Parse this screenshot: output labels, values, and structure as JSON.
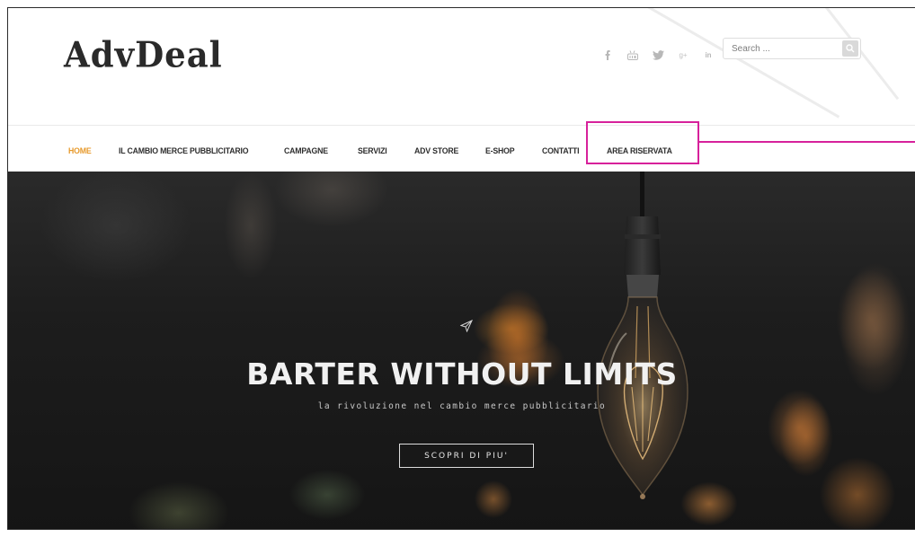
{
  "header": {
    "logo_text": "AdvDeal",
    "social_icons": [
      "facebook-icon",
      "youtube-icon",
      "twitter-icon",
      "google-plus-icon",
      "linkedin-icon"
    ],
    "search": {
      "placeholder": "Search ..."
    }
  },
  "nav": {
    "items": [
      {
        "label": "HOME",
        "active": true
      },
      {
        "label": "IL CAMBIO MERCE PUBBLICITARIO",
        "active": false
      },
      {
        "label": "CAMPAGNE",
        "active": false
      },
      {
        "label": "SERVIZI",
        "active": false
      },
      {
        "label": "ADV STORE",
        "active": false
      },
      {
        "label": "E-SHOP",
        "active": false
      },
      {
        "label": "CONTATTI",
        "active": false
      },
      {
        "label": "AREA RISERVATA",
        "active": false
      }
    ],
    "highlighted_item": "AREA RISERVATA"
  },
  "hero": {
    "title": "BARTER WITHOUT LIMITS",
    "subtitle": "la rivoluzione nel cambio merce pubblicitario",
    "button_label": "SCOPRI DI PIU'"
  },
  "colors": {
    "nav_active": "#e79a2c",
    "highlight": "#d7219b",
    "hero_text": "#f1f1f1"
  }
}
